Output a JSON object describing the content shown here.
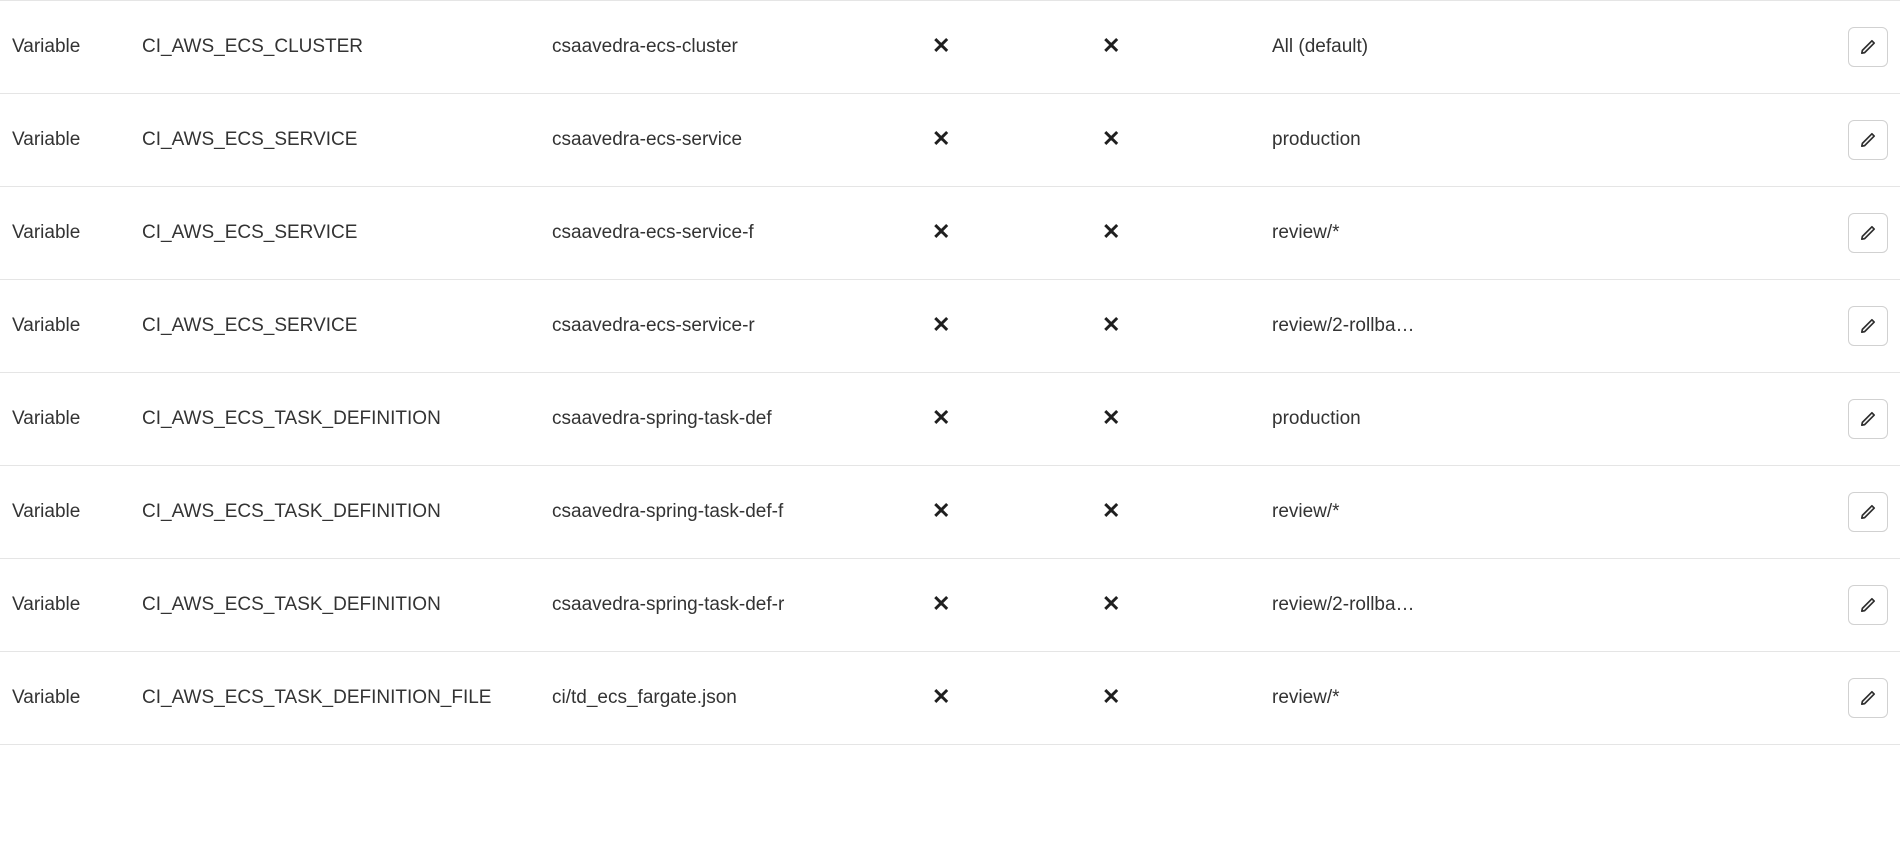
{
  "variables": [
    {
      "type": "Variable",
      "key": "CI_AWS_ECS_CLUSTER",
      "value": "csaavedra-ecs-cluster",
      "env": "All (default)"
    },
    {
      "type": "Variable",
      "key": "CI_AWS_ECS_SERVICE",
      "value": "csaavedra-ecs-service",
      "env": "production"
    },
    {
      "type": "Variable",
      "key": "CI_AWS_ECS_SERVICE",
      "value": "csaavedra-ecs-service-f",
      "env": "review/*"
    },
    {
      "type": "Variable",
      "key": "CI_AWS_ECS_SERVICE",
      "value": "csaavedra-ecs-service-r",
      "env": "review/2-rollba…"
    },
    {
      "type": "Variable",
      "key": "CI_AWS_ECS_TASK_DEFINITION",
      "value": "csaavedra-spring-task-def",
      "env": "production"
    },
    {
      "type": "Variable",
      "key": "CI_AWS_ECS_TASK_DEFINITION",
      "value": "csaavedra-spring-task-def-f",
      "env": "review/*"
    },
    {
      "type": "Variable",
      "key": "CI_AWS_ECS_TASK_DEFINITION",
      "value": "csaavedra-spring-task-def-r",
      "env": "review/2-rollba…"
    },
    {
      "type": "Variable",
      "key": "CI_AWS_ECS_TASK_DEFINITION_FILE",
      "value": "ci/td_ecs_fargate.json",
      "env": "review/*"
    }
  ]
}
